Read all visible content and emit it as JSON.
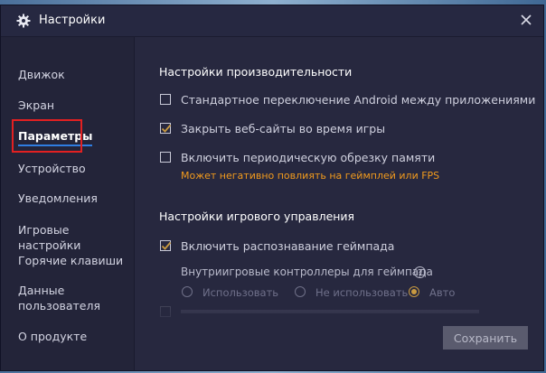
{
  "window": {
    "title": "Настройки"
  },
  "sidebar": {
    "items": [
      {
        "label": "Движок"
      },
      {
        "label": "Экран"
      },
      {
        "label": "Параметры"
      },
      {
        "label": "Устройство"
      },
      {
        "label": "Уведомления"
      },
      {
        "label": "Игровые настройки"
      },
      {
        "label": "Горячие клавиши"
      },
      {
        "label": "Данные пользователя"
      },
      {
        "label": "О продукте"
      }
    ],
    "active_index": 2
  },
  "performance": {
    "title": "Настройки производительности",
    "options": [
      {
        "label": "Стандартное переключение Android между приложениями",
        "checked": false
      },
      {
        "label": "Закрыть веб-сайты во время игры",
        "checked": true
      },
      {
        "label": "Включить периодическую обрезку памяти",
        "checked": false
      }
    ],
    "warning": "Может негативно повлиять на геймплей или FPS"
  },
  "game_control": {
    "title": "Настройки игрового управления",
    "gamepad_detection": {
      "label": "Включить распознавание геймпада",
      "checked": true
    },
    "controllers_label": "Внутриигровые контроллеры для геймпада",
    "radio_options": [
      {
        "label": "Использовать",
        "selected": false
      },
      {
        "label": "Не использовать",
        "selected": false
      },
      {
        "label": "Авто",
        "selected": true
      }
    ]
  },
  "footer": {
    "save_label": "Сохранить"
  },
  "colors": {
    "accent": "#2f7de1",
    "warning": "#f29b1d",
    "highlight": "#e22021",
    "radio_selected": "#c99a40"
  },
  "icons": {
    "title": "gear-icon",
    "close": "close-icon",
    "checkmark": "checkmark-icon",
    "help": "help-icon"
  }
}
